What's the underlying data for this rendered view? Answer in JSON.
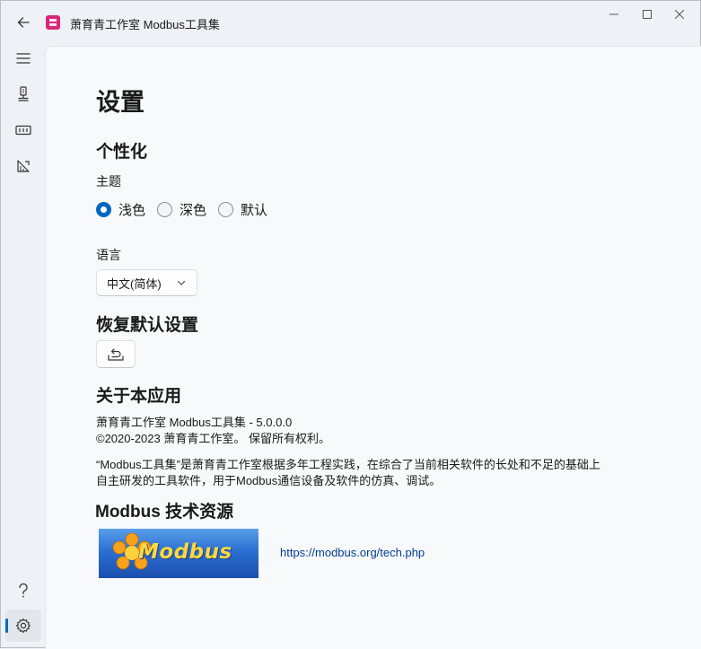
{
  "window": {
    "title": "萧育青工作室 Modbus工具集"
  },
  "page": {
    "title": "设置"
  },
  "personalization": {
    "heading": "个性化",
    "theme_label": "主题",
    "theme_options": [
      {
        "label": "浅色",
        "selected": true
      },
      {
        "label": "深色",
        "selected": false
      },
      {
        "label": "默认",
        "selected": false
      }
    ],
    "language_label": "语言",
    "language_value": "中文(简体)"
  },
  "restore": {
    "heading": "恢复默认设置"
  },
  "about": {
    "heading": "关于本应用",
    "version_line": "萧育青工作室 Modbus工具集 - 5.0.0.0",
    "copyright_line": "©2020-2023 萧育青工作室。 保留所有权利。",
    "description_line1": "“Modbus工具集”是萧育青工作室根据多年工程实践，在综合了当前相关软件的长处和不足的基础上",
    "description_line2": "自主研发的工具软件，用于Modbus通信设备及软件的仿真、调试。"
  },
  "resources": {
    "heading": "Modbus 技术资源",
    "logo_text": "Modbus",
    "link_text": "https://modbus.org/tech.php"
  },
  "colors": {
    "accent": "#0067c0",
    "link": "#003e92",
    "app_logo": "#d9257a"
  }
}
